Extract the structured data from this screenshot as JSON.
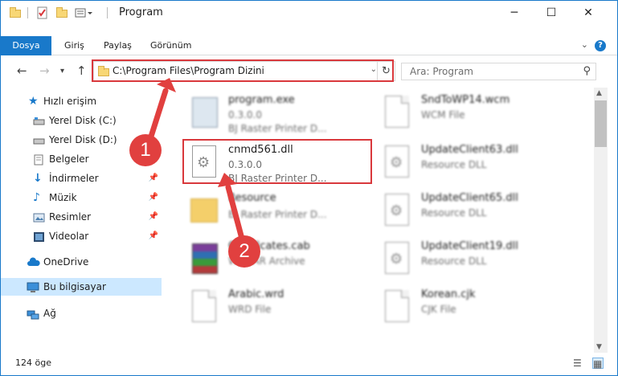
{
  "window": {
    "title": "Program",
    "minimize_icon": "minimize-icon",
    "maximize_icon": "maximize-icon",
    "close_icon": "close-icon"
  },
  "ribbon": {
    "tabs": [
      "Dosya",
      "Giriş",
      "Paylaş",
      "Görünüm"
    ],
    "help": "?"
  },
  "address": {
    "path": "C:\\Program Files\\Program Dizini",
    "search_placeholder": "Ara: Program"
  },
  "nav": {
    "items": [
      {
        "label": "Hızlı erişim",
        "icon": "star-icon"
      },
      {
        "label": "Yerel Disk (C:)",
        "icon": "drive-icon"
      },
      {
        "label": "Yerel Disk (D:)",
        "icon": "drive-icon"
      },
      {
        "label": "Belgeler",
        "icon": "documents-icon"
      },
      {
        "label": "İndirmeler",
        "icon": "download-icon",
        "pinned": true
      },
      {
        "label": "Müzik",
        "icon": "music-icon",
        "pinned": true
      },
      {
        "label": "Resimler",
        "icon": "pictures-icon",
        "pinned": true
      },
      {
        "label": "Videolar",
        "icon": "videos-icon",
        "pinned": true
      },
      {
        "label": "OneDrive",
        "icon": "cloud-icon"
      },
      {
        "label": "Bu bilgisayar",
        "icon": "computer-icon",
        "selected": true
      },
      {
        "label": "Ağ",
        "icon": "network-icon"
      }
    ]
  },
  "files": [
    {
      "name": "program.exe",
      "line1": "0.3.0.0",
      "line2": "BJ Raster Printer D...",
      "icon": "exe-icon"
    },
    {
      "name": "SndToWP14.wcm",
      "line1": "WCM File",
      "line2": "",
      "icon": "document-icon"
    },
    {
      "name": "cnmd561.dll",
      "line1": "0.3.0.0",
      "line2": "BJ Raster Printer D...",
      "icon": "dll-icon"
    },
    {
      "name": "UpdateClient63.dll",
      "line1": "Resource DLL",
      "line2": "",
      "icon": "dll-icon"
    },
    {
      "name": "Resource",
      "line1": "BJ Raster Printer D...",
      "line2": "",
      "icon": "folder-icon"
    },
    {
      "name": "UpdateClient65.dll",
      "line1": "Resource DLL",
      "line2": "",
      "icon": "dll-icon"
    },
    {
      "name": "Certificates.cab",
      "line1": "WinRAR Archive",
      "line2": "",
      "icon": "archive-icon"
    },
    {
      "name": "UpdateClient19.dll",
      "line1": "Resource DLL",
      "line2": "",
      "icon": "dll-icon"
    },
    {
      "name": "Arabic.wrd",
      "line1": "WRD File",
      "line2": "",
      "icon": "document-icon"
    },
    {
      "name": "Korean.cjk",
      "line1": "CJK File",
      "line2": "",
      "icon": "document-icon"
    }
  ],
  "annotations": {
    "marker1": "1",
    "marker2": "2",
    "accent": "#d9383c"
  },
  "status": {
    "count": "124 öge"
  },
  "colors": {
    "accent": "#1979ca",
    "selection": "#cce8ff",
    "annotation": "#e1403f"
  }
}
